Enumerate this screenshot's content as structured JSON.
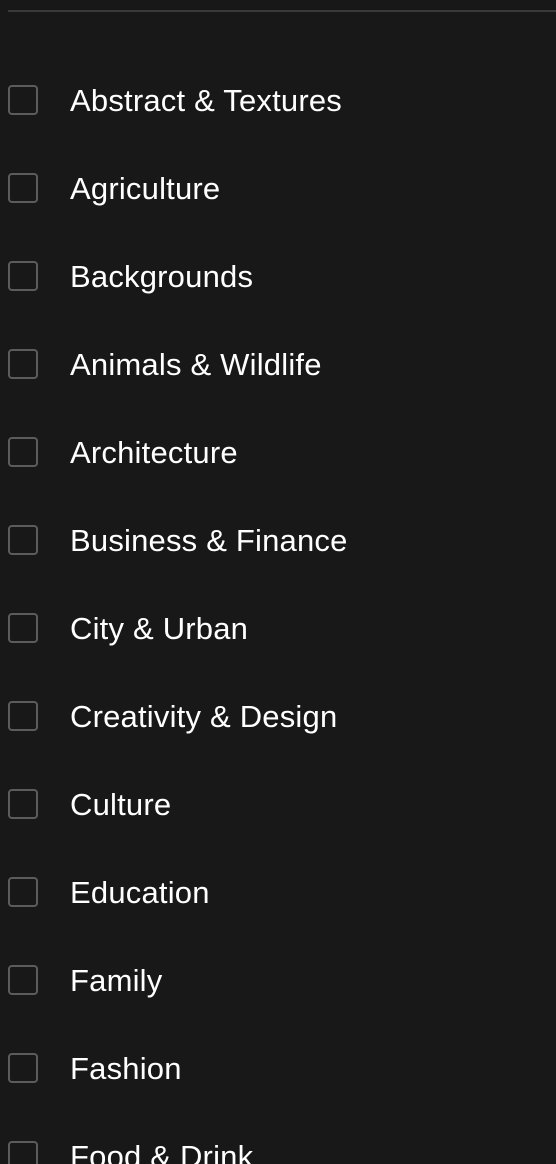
{
  "filters": {
    "categories": [
      {
        "label": "Abstract & Textures",
        "checked": false
      },
      {
        "label": "Agriculture",
        "checked": false
      },
      {
        "label": "Backgrounds",
        "checked": false
      },
      {
        "label": "Animals & Wildlife",
        "checked": false
      },
      {
        "label": "Architecture",
        "checked": false
      },
      {
        "label": "Business & Finance",
        "checked": false
      },
      {
        "label": "City & Urban",
        "checked": false
      },
      {
        "label": "Creativity & Design",
        "checked": false
      },
      {
        "label": "Culture",
        "checked": false
      },
      {
        "label": "Education",
        "checked": false
      },
      {
        "label": "Family",
        "checked": false
      },
      {
        "label": "Fashion",
        "checked": false
      },
      {
        "label": "Food & Drink",
        "checked": false
      }
    ]
  },
  "colors": {
    "background": "#181818",
    "text": "#ffffff",
    "checkbox_border": "#5c5c5c",
    "divider": "#3a3a3a"
  }
}
